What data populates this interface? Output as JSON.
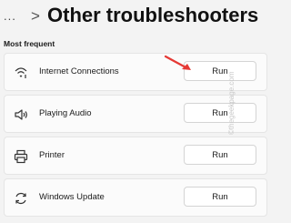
{
  "header": {
    "breadcrumb_overflow": "...",
    "separator": ">",
    "title": "Other troubleshooters"
  },
  "section": {
    "title": "Most frequent"
  },
  "troubleshooters": [
    {
      "label": "Internet Connections",
      "icon": "wifi-icon",
      "button": "Run"
    },
    {
      "label": "Playing Audio",
      "icon": "speaker-icon",
      "button": "Run"
    },
    {
      "label": "Printer",
      "icon": "printer-icon",
      "button": "Run"
    },
    {
      "label": "Windows Update",
      "icon": "refresh-icon",
      "button": "Run"
    }
  ],
  "annotation": {
    "arrow_color": "#e53935"
  },
  "watermark": {
    "text": "©thegeekpage.com"
  }
}
